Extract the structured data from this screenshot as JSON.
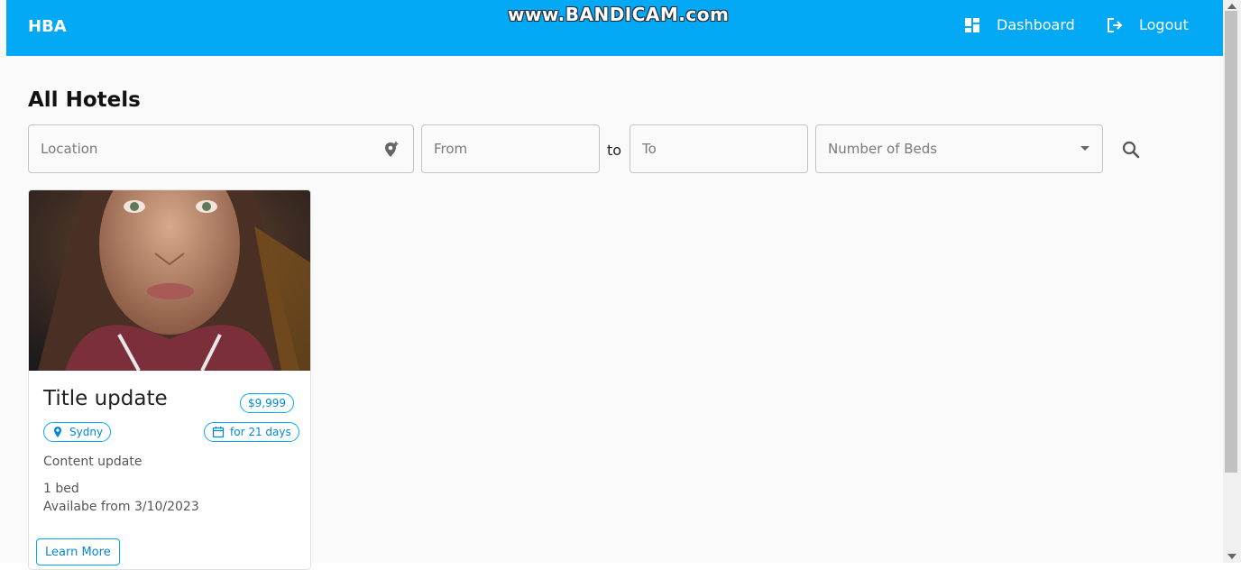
{
  "watermark": "www.BANDICAM.com",
  "header": {
    "brand": "HBA",
    "nav": [
      {
        "label": "Dashboard",
        "icon": "dashboard-icon"
      },
      {
        "label": "Logout",
        "icon": "logout-icon"
      }
    ],
    "color": "#03a9f4"
  },
  "page": {
    "title": "All Hotels"
  },
  "filters": {
    "location_placeholder": "Location",
    "from_placeholder": "From",
    "separator": "to",
    "to_placeholder": "To",
    "beds_placeholder": "Number of Beds",
    "icons": [
      "add-location-icon",
      "dropdown-arrow-icon",
      "search-icon"
    ]
  },
  "hotels": [
    {
      "title": "Title update",
      "price": "$9,999",
      "location": "Sydny",
      "duration": "for 21 days",
      "content": "Content update",
      "beds": "1 bed",
      "available": "Availabe from 3/10/2023",
      "button": "Learn More"
    }
  ]
}
